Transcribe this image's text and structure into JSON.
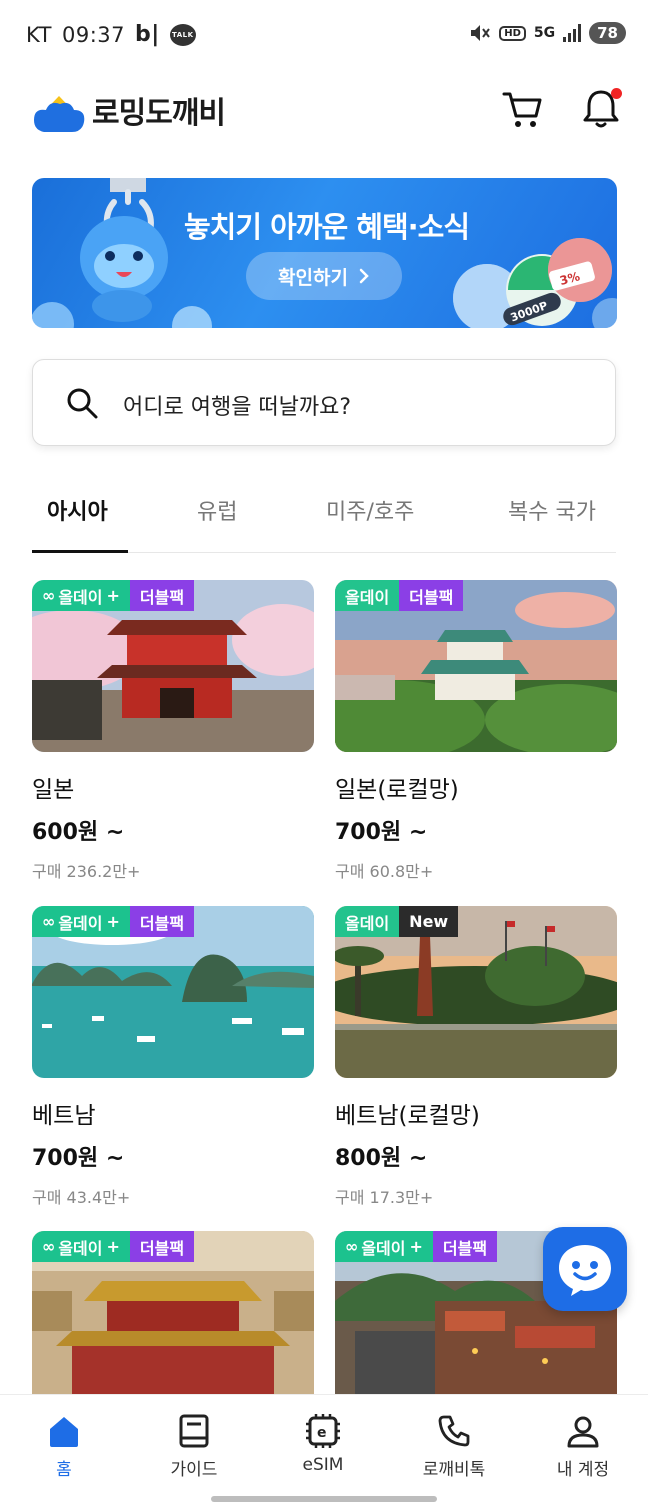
{
  "status_bar": {
    "carrier": "KT",
    "time": "09:37",
    "b_icon": "b|",
    "talk_icon": "TALK",
    "hd": "HD",
    "network": "5G",
    "battery": "78"
  },
  "header": {
    "logo_text": "로밍도깨비",
    "icons": [
      "cart-icon",
      "bell-icon"
    ]
  },
  "banner": {
    "title": "놓치기 아까운 혜택·소식",
    "button_label": "확인하기",
    "deco_3pct": "3%",
    "deco_3000p": "3000P"
  },
  "search": {
    "placeholder": "어디로 여행을 떠날까요?"
  },
  "tabs": [
    {
      "label": "아시아",
      "active": true
    },
    {
      "label": "유럽",
      "active": false
    },
    {
      "label": "미주/호주",
      "active": false
    },
    {
      "label": "복수 국가",
      "active": false
    }
  ],
  "cards": [
    {
      "name": "일본",
      "price": "600원 ~",
      "sales": "구매 236.2만+",
      "badge1": "올데이",
      "badge1_plus": true,
      "badge2": "더블팩"
    },
    {
      "name": "일본(로컬망)",
      "price": "700원 ~",
      "sales": "구매 60.8만+",
      "badge1": "올데이",
      "badge1_plus": false,
      "badge2": "더블팩"
    },
    {
      "name": "베트남",
      "price": "700원 ~",
      "sales": "구매 43.4만+",
      "badge1": "올데이",
      "badge1_plus": true,
      "badge2": "더블팩"
    },
    {
      "name": "베트남(로컬망)",
      "price": "800원 ~",
      "sales": "구매 17.3만+",
      "badge1": "올데이",
      "badge1_plus": false,
      "badge2": "New"
    },
    {
      "name": "",
      "price": "",
      "sales": "",
      "badge1": "올데이",
      "badge1_plus": true,
      "badge2": "더블팩"
    },
    {
      "name": "",
      "price": "",
      "sales": "",
      "badge1": "올데이",
      "badge1_plus": true,
      "badge2": "더블팩"
    }
  ],
  "bottom_nav": [
    {
      "label": "홈",
      "icon": "home-icon",
      "active": true
    },
    {
      "label": "가이드",
      "icon": "guide-book-icon",
      "active": false
    },
    {
      "label": "eSIM",
      "icon": "esim-chip-icon",
      "active": false
    },
    {
      "label": "로깨비톡",
      "icon": "phone-icon",
      "active": false
    },
    {
      "label": "내 계정",
      "icon": "user-icon",
      "active": false
    }
  ],
  "colors": {
    "brand_blue": "#1e6de6",
    "allday_green": "#23c38d",
    "doublepack_purple": "#8b3fe6",
    "new_dark": "#2b2b2b",
    "notification_red": "#f02424"
  }
}
